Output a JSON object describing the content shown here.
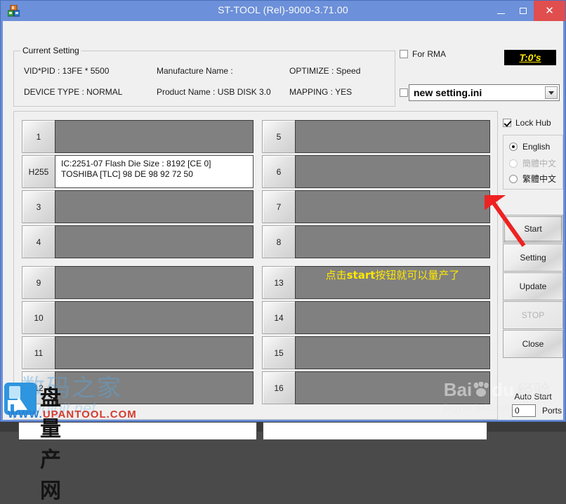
{
  "window": {
    "title": "ST-TOOL (Rel)-9000-3.71.00",
    "icon": "app-blocks-icon",
    "minimize_label": "–",
    "maximize_label": "□",
    "close_label": "✕",
    "close_color": "#e04e4e",
    "titlebar_color": "#6c90d9"
  },
  "current_setting": {
    "legend": "Current Setting",
    "vid_pid": "VID*PID : 13FE * 5500",
    "device_type": "DEVICE TYPE : NORMAL",
    "manufacture_name": "Manufacture Name :",
    "product_name": "Product Name : USB DISK 3.0",
    "optimize": "OPTIMIZE : Speed",
    "mapping": "MAPPING : YES"
  },
  "top_right": {
    "timer_label": "T:0's",
    "timer_text_color": "#ffe800",
    "timer_bg_color": "#000000",
    "for_rma_label": "For RMA",
    "for_rma_checked": false,
    "ini_checkbox_checked": false,
    "ini_selected": "new setting.ini",
    "dropdown_icon": "chevron-down-icon"
  },
  "rail": {
    "lock_hub_label": "Lock Hub",
    "lock_hub_checked": true,
    "languages": [
      {
        "label": "English",
        "selected": true,
        "disabled": false
      },
      {
        "label": "簡體中文",
        "selected": false,
        "disabled": true
      },
      {
        "label": "繁體中文",
        "selected": false,
        "disabled": false
      }
    ],
    "buttons": [
      {
        "label": "Start",
        "disabled": false,
        "focused": true
      },
      {
        "label": "Setting",
        "disabled": false,
        "focused": false
      },
      {
        "label": "Update",
        "disabled": false,
        "focused": false
      },
      {
        "label": "STOP",
        "disabled": true,
        "focused": false
      },
      {
        "label": "Close",
        "disabled": false,
        "focused": false
      }
    ],
    "auto_start_label": "Auto Start",
    "auto_start_value": "0",
    "auto_start_unit": "Ports"
  },
  "ports": {
    "left": [
      {
        "label": "1",
        "active": false,
        "lines": []
      },
      {
        "label": "H255",
        "active": true,
        "lines": [
          "IC:2251-07 Flash Die Size : 8192 [CE 0]",
          "TOSHIBA [TLC] 98 DE 98 92 72 50"
        ]
      },
      {
        "label": "3",
        "active": false,
        "lines": []
      },
      {
        "label": "4",
        "active": false,
        "lines": []
      },
      {
        "label": "9",
        "active": false,
        "lines": []
      },
      {
        "label": "10",
        "active": false,
        "lines": []
      },
      {
        "label": "11",
        "active": false,
        "lines": []
      },
      {
        "label": "12",
        "active": false,
        "lines": []
      }
    ],
    "right": [
      {
        "label": "5",
        "active": false,
        "lines": []
      },
      {
        "label": "6",
        "active": false,
        "lines": []
      },
      {
        "label": "7",
        "active": false,
        "lines": []
      },
      {
        "label": "8",
        "active": false,
        "lines": []
      },
      {
        "label": "13",
        "active": false,
        "lines": [],
        "note_prefix": "点击",
        "note_bold": "start",
        "note_suffix": "按钮就可以量产了"
      },
      {
        "label": "14",
        "active": false,
        "lines": []
      },
      {
        "label": "15",
        "active": false,
        "lines": []
      },
      {
        "label": "16",
        "active": false,
        "lines": []
      }
    ]
  },
  "bottom": {
    "left_box_value": "",
    "right_box_value": ""
  },
  "annotations": {
    "arrow_color": "#ee2222",
    "note_color": "#ffe800"
  },
  "watermarks": {
    "mydigit_cn": "数码之家",
    "mydigit_en": "mydigit.net",
    "upantool_cn": "盘量产网",
    "upantool_www": "WWW.",
    "upantool_domain": "UPANTOOL.COM",
    "baidu_brand": "Bai",
    "baidu_suffix": "du",
    "baidu_cn": "经验",
    "baidu_url": "jingyan.baidu.com"
  }
}
